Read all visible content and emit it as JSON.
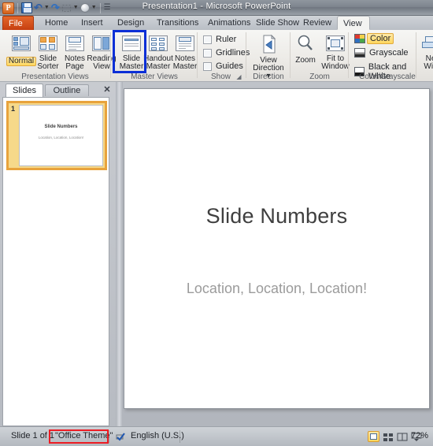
{
  "window": {
    "title": "Presentation1  -  Microsoft PowerPoint",
    "app_logo": "powerpoint-logo"
  },
  "quick_access": {
    "items": [
      {
        "name": "save-icon",
        "label": "Save"
      },
      {
        "name": "undo-icon",
        "label": "Undo"
      },
      {
        "name": "undo-dropdown-icon",
        "label": "Undo options"
      },
      {
        "name": "redo-icon",
        "label": "Redo"
      },
      {
        "name": "start-slideshow-icon",
        "label": "Start From Beginning"
      },
      {
        "name": "customize-qat-icon",
        "label": "Customize Quick Access Toolbar"
      }
    ]
  },
  "ribbon": {
    "tabs": [
      {
        "label": "File",
        "active": false,
        "file": true
      },
      {
        "label": "Home",
        "active": false
      },
      {
        "label": "Insert",
        "active": false
      },
      {
        "label": "Design",
        "active": false
      },
      {
        "label": "Transitions",
        "active": false
      },
      {
        "label": "Animations",
        "active": false
      },
      {
        "label": "Slide Show",
        "active": false
      },
      {
        "label": "Review",
        "active": false
      },
      {
        "label": "View",
        "active": true
      }
    ],
    "groups": {
      "presentation_views": {
        "label": "Presentation Views",
        "buttons": [
          {
            "label": "Normal",
            "icon": "normal-view-icon",
            "selected": true
          },
          {
            "label": "Slide\nSorter",
            "line1": "Slide",
            "line2": "Sorter",
            "icon": "slide-sorter-icon",
            "selected": false
          },
          {
            "label": "Notes\nPage",
            "line1": "Notes",
            "line2": "Page",
            "icon": "notes-page-icon",
            "selected": false
          },
          {
            "label": "Reading\nView",
            "line1": "Reading",
            "line2": "View",
            "icon": "reading-view-icon",
            "selected": false
          }
        ]
      },
      "master_views": {
        "label": "Master Views",
        "buttons": [
          {
            "line1": "Slide",
            "line2": "Master",
            "icon": "slide-master-icon",
            "highlighted": true
          },
          {
            "line1": "Handout",
            "line2": "Master",
            "icon": "handout-master-icon",
            "highlighted": false
          },
          {
            "line1": "Notes",
            "line2": "Master",
            "icon": "notes-master-icon",
            "highlighted": false
          }
        ]
      },
      "show": {
        "label": "Show",
        "checkboxes": [
          {
            "label": "Ruler",
            "checked": false
          },
          {
            "label": "Gridlines",
            "checked": false
          },
          {
            "label": "Guides",
            "checked": false
          }
        ],
        "launcher": "dialog-box-launcher"
      },
      "direction": {
        "label": "Direction",
        "buttons": [
          {
            "line1": "View",
            "line2": "Direction ▾",
            "icon": "view-direction-icon"
          }
        ]
      },
      "zoom": {
        "label": "Zoom",
        "buttons": [
          {
            "line1": "Zoom",
            "line2": "",
            "icon": "zoom-icon"
          },
          {
            "line1": "Fit to",
            "line2": "Window",
            "icon": "fit-to-window-icon"
          }
        ]
      },
      "color_grayscale": {
        "label": "Color/Grayscale",
        "options": [
          {
            "label": "Color",
            "icon": "color-swatch-icon",
            "selected": true
          },
          {
            "label": "Grayscale",
            "icon": "grayscale-swatch-icon",
            "selected": false
          },
          {
            "label": "Black and White",
            "icon": "black-white-swatch-icon",
            "selected": false
          }
        ]
      },
      "window": {
        "label": "",
        "buttons": [
          {
            "line1": "Ne",
            "line2": "Win",
            "icon": "new-window-icon"
          }
        ]
      }
    }
  },
  "slide_pane": {
    "tabs": [
      {
        "label": "Slides",
        "active": true
      },
      {
        "label": "Outline",
        "active": false
      }
    ],
    "close_label": "✕",
    "thumbnails": [
      {
        "number": "1",
        "title": "Slide Numbers",
        "subtitle": "Location, Location, Location!",
        "selected": true
      }
    ]
  },
  "slide": {
    "title": "Slide Numbers",
    "subtitle": "Location, Location, Location!"
  },
  "status_bar": {
    "slide_count": "Slide 1 of 1",
    "theme": "\"Office Theme\"",
    "spell_check_icon": "spell-check-icon",
    "language": "English (U.S.)",
    "zoom_level": "72%",
    "view_buttons": [
      {
        "name": "normal-view-button",
        "selected": true
      },
      {
        "name": "slide-sorter-view-button",
        "selected": false
      },
      {
        "name": "reading-view-button",
        "selected": false
      },
      {
        "name": "slide-show-view-button",
        "selected": false
      }
    ]
  },
  "annotations": {
    "blue_box_target": "Slide Master button",
    "red_box_target": "\"Office Theme\" status item"
  },
  "colors": {
    "file_tab": "#c63f10",
    "highlight": "#ffd75e",
    "annotation_blue": "#0b2fd6",
    "annotation_red": "#ed1c24",
    "thumb_selection": "#e8a33d"
  }
}
